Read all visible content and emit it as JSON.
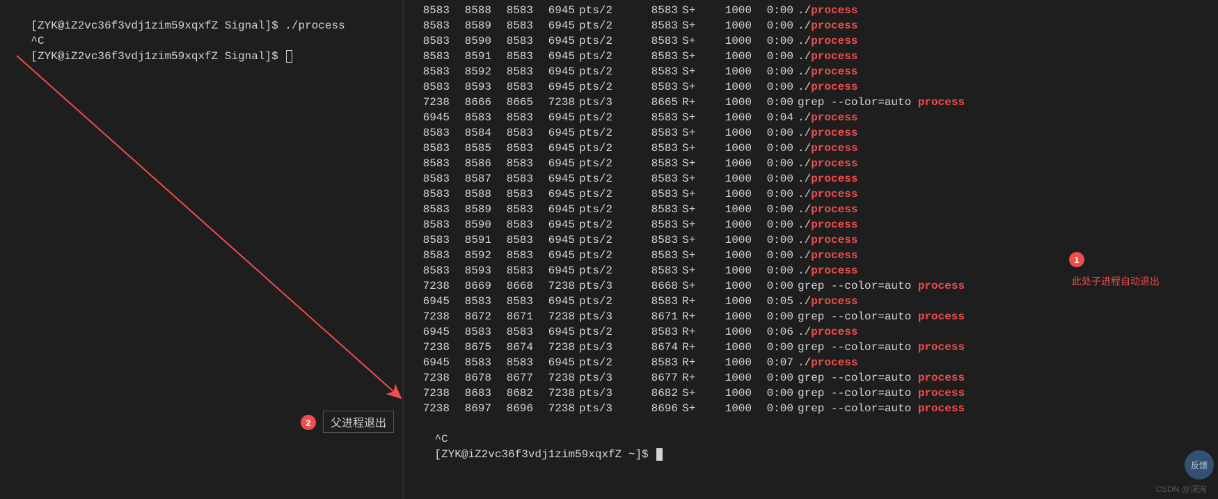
{
  "left": {
    "prompt1": "[ZYK@iZ2vc36f3vdj1zim59xqxfZ Signal]$ ",
    "cmd1": "./process",
    "ctrlc": "^C",
    "prompt2": "[ZYK@iZ2vc36f3vdj1zim59xqxfZ Signal]$ "
  },
  "right": {
    "rows": [
      {
        "c1": "8583",
        "c2": "8588",
        "c3": "8583",
        "c4": "6945",
        "c5": "pts/2",
        "c6": "8583",
        "c7": "S+",
        "c8": "1000",
        "c9": "0:00",
        "cmd": "./",
        "key": "process"
      },
      {
        "c1": "8583",
        "c2": "8589",
        "c3": "8583",
        "c4": "6945",
        "c5": "pts/2",
        "c6": "8583",
        "c7": "S+",
        "c8": "1000",
        "c9": "0:00",
        "cmd": "./",
        "key": "process"
      },
      {
        "c1": "8583",
        "c2": "8590",
        "c3": "8583",
        "c4": "6945",
        "c5": "pts/2",
        "c6": "8583",
        "c7": "S+",
        "c8": "1000",
        "c9": "0:00",
        "cmd": "./",
        "key": "process"
      },
      {
        "c1": "8583",
        "c2": "8591",
        "c3": "8583",
        "c4": "6945",
        "c5": "pts/2",
        "c6": "8583",
        "c7": "S+",
        "c8": "1000",
        "c9": "0:00",
        "cmd": "./",
        "key": "process"
      },
      {
        "c1": "8583",
        "c2": "8592",
        "c3": "8583",
        "c4": "6945",
        "c5": "pts/2",
        "c6": "8583",
        "c7": "S+",
        "c8": "1000",
        "c9": "0:00",
        "cmd": "./",
        "key": "process"
      },
      {
        "c1": "8583",
        "c2": "8593",
        "c3": "8583",
        "c4": "6945",
        "c5": "pts/2",
        "c6": "8583",
        "c7": "S+",
        "c8": "1000",
        "c9": "0:00",
        "cmd": "./",
        "key": "process"
      },
      {
        "c1": "7238",
        "c2": "8666",
        "c3": "8665",
        "c4": "7238",
        "c5": "pts/3",
        "c6": "8665",
        "c7": "R+",
        "c8": "1000",
        "c9": "0:00",
        "cmd": "grep --color=auto ",
        "key": "process"
      },
      {
        "c1": "6945",
        "c2": "8583",
        "c3": "8583",
        "c4": "6945",
        "c5": "pts/2",
        "c6": "8583",
        "c7": "S+",
        "c8": "1000",
        "c9": "0:04",
        "cmd": "./",
        "key": "process"
      },
      {
        "c1": "8583",
        "c2": "8584",
        "c3": "8583",
        "c4": "6945",
        "c5": "pts/2",
        "c6": "8583",
        "c7": "S+",
        "c8": "1000",
        "c9": "0:00",
        "cmd": "./",
        "key": "process"
      },
      {
        "c1": "8583",
        "c2": "8585",
        "c3": "8583",
        "c4": "6945",
        "c5": "pts/2",
        "c6": "8583",
        "c7": "S+",
        "c8": "1000",
        "c9": "0:00",
        "cmd": "./",
        "key": "process"
      },
      {
        "c1": "8583",
        "c2": "8586",
        "c3": "8583",
        "c4": "6945",
        "c5": "pts/2",
        "c6": "8583",
        "c7": "S+",
        "c8": "1000",
        "c9": "0:00",
        "cmd": "./",
        "key": "process"
      },
      {
        "c1": "8583",
        "c2": "8587",
        "c3": "8583",
        "c4": "6945",
        "c5": "pts/2",
        "c6": "8583",
        "c7": "S+",
        "c8": "1000",
        "c9": "0:00",
        "cmd": "./",
        "key": "process"
      },
      {
        "c1": "8583",
        "c2": "8588",
        "c3": "8583",
        "c4": "6945",
        "c5": "pts/2",
        "c6": "8583",
        "c7": "S+",
        "c8": "1000",
        "c9": "0:00",
        "cmd": "./",
        "key": "process"
      },
      {
        "c1": "8583",
        "c2": "8589",
        "c3": "8583",
        "c4": "6945",
        "c5": "pts/2",
        "c6": "8583",
        "c7": "S+",
        "c8": "1000",
        "c9": "0:00",
        "cmd": "./",
        "key": "process"
      },
      {
        "c1": "8583",
        "c2": "8590",
        "c3": "8583",
        "c4": "6945",
        "c5": "pts/2",
        "c6": "8583",
        "c7": "S+",
        "c8": "1000",
        "c9": "0:00",
        "cmd": "./",
        "key": "process"
      },
      {
        "c1": "8583",
        "c2": "8591",
        "c3": "8583",
        "c4": "6945",
        "c5": "pts/2",
        "c6": "8583",
        "c7": "S+",
        "c8": "1000",
        "c9": "0:00",
        "cmd": "./",
        "key": "process"
      },
      {
        "c1": "8583",
        "c2": "8592",
        "c3": "8583",
        "c4": "6945",
        "c5": "pts/2",
        "c6": "8583",
        "c7": "S+",
        "c8": "1000",
        "c9": "0:00",
        "cmd": "./",
        "key": "process"
      },
      {
        "c1": "8583",
        "c2": "8593",
        "c3": "8583",
        "c4": "6945",
        "c5": "pts/2",
        "c6": "8583",
        "c7": "S+",
        "c8": "1000",
        "c9": "0:00",
        "cmd": "./",
        "key": "process"
      },
      {
        "c1": "7238",
        "c2": "8669",
        "c3": "8668",
        "c4": "7238",
        "c5": "pts/3",
        "c6": "8668",
        "c7": "S+",
        "c8": "1000",
        "c9": "0:00",
        "cmd": "grep --color=auto ",
        "key": "process"
      },
      {
        "c1": "6945",
        "c2": "8583",
        "c3": "8583",
        "c4": "6945",
        "c5": "pts/2",
        "c6": "8583",
        "c7": "R+",
        "c8": "1000",
        "c9": "0:05",
        "cmd": "./",
        "key": "process"
      },
      {
        "c1": "7238",
        "c2": "8672",
        "c3": "8671",
        "c4": "7238",
        "c5": "pts/3",
        "c6": "8671",
        "c7": "R+",
        "c8": "1000",
        "c9": "0:00",
        "cmd": "grep --color=auto ",
        "key": "process"
      },
      {
        "c1": "6945",
        "c2": "8583",
        "c3": "8583",
        "c4": "6945",
        "c5": "pts/2",
        "c6": "8583",
        "c7": "R+",
        "c8": "1000",
        "c9": "0:06",
        "cmd": "./",
        "key": "process"
      },
      {
        "c1": "7238",
        "c2": "8675",
        "c3": "8674",
        "c4": "7238",
        "c5": "pts/3",
        "c6": "8674",
        "c7": "R+",
        "c8": "1000",
        "c9": "0:00",
        "cmd": "grep --color=auto ",
        "key": "process"
      },
      {
        "c1": "6945",
        "c2": "8583",
        "c3": "8583",
        "c4": "6945",
        "c5": "pts/2",
        "c6": "8583",
        "c7": "R+",
        "c8": "1000",
        "c9": "0:07",
        "cmd": "./",
        "key": "process"
      },
      {
        "c1": "7238",
        "c2": "8678",
        "c3": "8677",
        "c4": "7238",
        "c5": "pts/3",
        "c6": "8677",
        "c7": "R+",
        "c8": "1000",
        "c9": "0:00",
        "cmd": "grep --color=auto ",
        "key": "process"
      },
      {
        "c1": "7238",
        "c2": "8683",
        "c3": "8682",
        "c4": "7238",
        "c5": "pts/3",
        "c6": "8682",
        "c7": "S+",
        "c8": "1000",
        "c9": "0:00",
        "cmd": "grep --color=auto ",
        "key": "process"
      },
      {
        "c1": "7238",
        "c2": "8697",
        "c3": "8696",
        "c4": "7238",
        "c5": "pts/3",
        "c6": "8696",
        "c7": "S+",
        "c8": "1000",
        "c9": "0:00",
        "cmd": "grep --color=auto ",
        "key": "process"
      }
    ],
    "ctrlc": "^C",
    "prompt": "[ZYK@iZ2vc36f3vdj1zim59xqxfZ ~]$ "
  },
  "annotations": {
    "badge1": "1",
    "text1": "此处子进程自动退出",
    "badge2": "2",
    "text2": "父进程退出"
  },
  "watermark": "CSDN @溟洵",
  "feedback": "反馈"
}
